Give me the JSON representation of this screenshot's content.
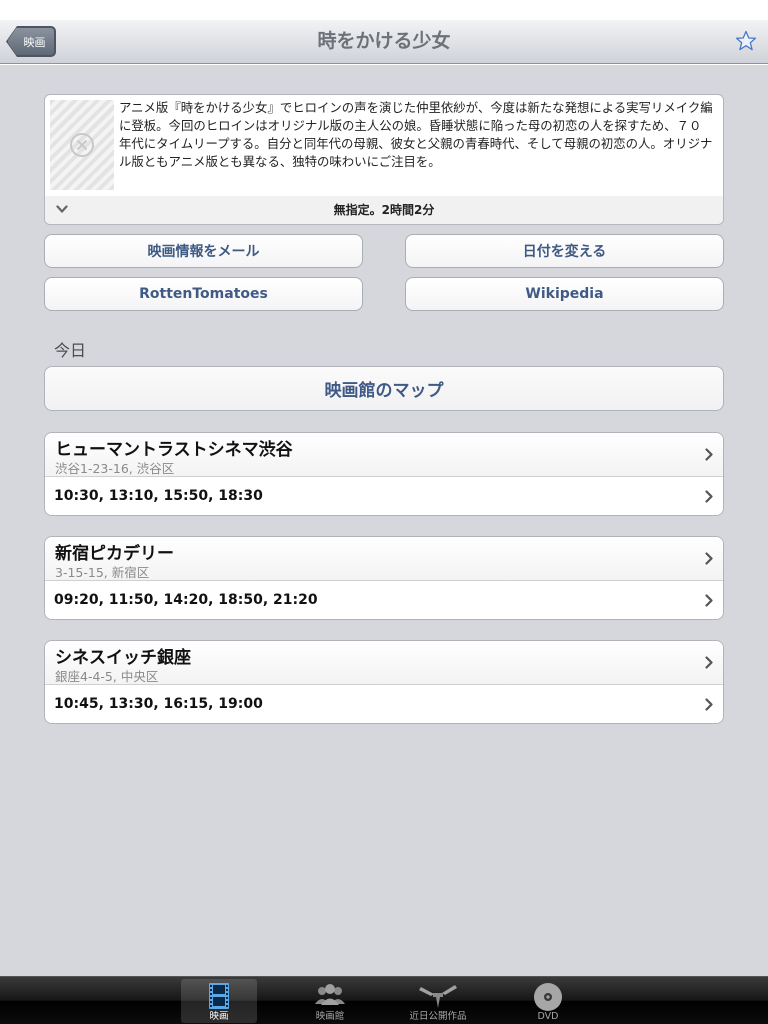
{
  "nav": {
    "back_label": "映画",
    "title": "時をかける少女"
  },
  "movie": {
    "synopsis": "アニメ版『時をかける少女』でヒロインの声を演じた仲里依紗が、今度は新たな発想による実写リメイク編に登板。今回のヒロインはオリジナル版の主人公の娘。昏睡状態に陥った母の初恋の人を探すため、７０年代にタイムリープする。自分と同年代の母親、彼女と父親の青春時代、そして母親の初恋の人。オリジナル版ともアニメ版とも異なる、独特の味わいにご注目を。",
    "runtime": "無指定。2時間2分"
  },
  "actions": {
    "email": "映画情報をメール",
    "change_date": "日付を変える",
    "rotten_tomatoes": "RottenTomatoes",
    "wikipedia": "Wikipedia"
  },
  "section_label": "今日",
  "map_button": "映画館のマップ",
  "theaters": [
    {
      "name": "ヒューマントラストシネマ渋谷",
      "address": "渋谷1-23-16, 渋谷区",
      "times": "10:30, 13:10, 15:50, 18:30"
    },
    {
      "name": "新宿ピカデリー",
      "address": "3-15-15, 新宿区",
      "times": "09:20, 11:50, 14:20, 18:50, 21:20"
    },
    {
      "name": "シネスイッチ銀座",
      "address": "銀座4-4-5, 中央区",
      "times": "10:45, 13:30, 16:15, 19:00"
    }
  ],
  "tabs": [
    {
      "label": "映画",
      "icon": "film-icon",
      "active": true
    },
    {
      "label": "映画館",
      "icon": "people-icon",
      "active": false
    },
    {
      "label": "近日公開作品",
      "icon": "clapper-icon",
      "active": false
    },
    {
      "label": "DVD",
      "icon": "disc-icon",
      "active": false
    }
  ],
  "colors": {
    "accent_text": "#3f5a85",
    "background": "#d5d7dc",
    "star": "#4a78c9"
  }
}
